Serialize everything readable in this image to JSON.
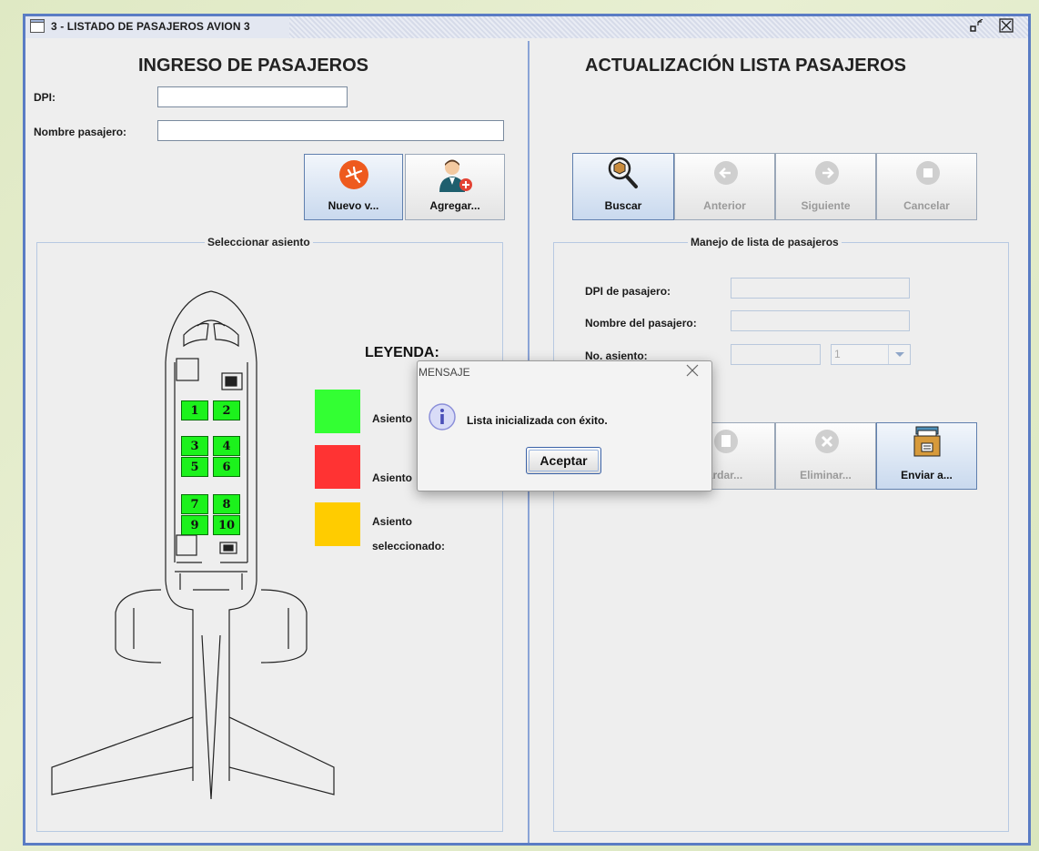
{
  "window": {
    "title": "3 - LISTADO DE PASAJEROS AVION 3",
    "restore_glyph": "ᵖᵏ",
    "close_icon": "close-box-icon"
  },
  "left": {
    "heading": "INGRESO DE PASAJEROS",
    "dpi_label": "DPI:",
    "dpi_value": "",
    "name_label": "Nombre pasajero:",
    "name_value": "",
    "buttons": [
      {
        "label": "Nuevo v...",
        "icon": "airplane-icon"
      },
      {
        "label": "Agregar...",
        "icon": "add-user-icon"
      }
    ],
    "seat_group_title": "Seleccionar asiento",
    "seats": [
      "1",
      "2",
      "3",
      "4",
      "5",
      "6",
      "7",
      "8",
      "9",
      "10"
    ],
    "legend": {
      "heading": "LEYENDA:",
      "items": [
        {
          "label": "Asiento",
          "color": "#33ff33"
        },
        {
          "label": "Asiento",
          "color": "#ff3333"
        },
        {
          "label": "Asiento",
          "label2": "seleccionado:",
          "color": "#ffcc00"
        }
      ]
    }
  },
  "right": {
    "heading": "ACTUALIZACIÓN LISTA PASAJEROS",
    "nav_buttons": [
      {
        "label": "Buscar",
        "icon": "search-icon",
        "enabled": true
      },
      {
        "label": "Anterior",
        "icon": "arrow-left-icon",
        "enabled": false
      },
      {
        "label": "Siguiente",
        "icon": "arrow-right-icon",
        "enabled": false
      },
      {
        "label": "Cancelar",
        "icon": "stop-icon",
        "enabled": false
      }
    ],
    "group_title": "Manejo de lista de pasajeros",
    "dpi_label": "DPI de pasajero:",
    "name_label": "Nombre del pasajero:",
    "seat_label": "No. asiento:",
    "seat_select_value": "1",
    "action_buttons": [
      {
        "label": "Guardar...",
        "visible_label": "ardar...",
        "icon": "save-icon",
        "enabled": false
      },
      {
        "label": "Eliminar...",
        "icon": "delete-icon",
        "enabled": false
      },
      {
        "label": "Enviar a...",
        "icon": "archive-icon",
        "enabled": true
      }
    ]
  },
  "dialog": {
    "title": "MENSAJE",
    "message": "Lista inicializada con éxito.",
    "ok_label": "Aceptar",
    "icon": "info-icon"
  }
}
